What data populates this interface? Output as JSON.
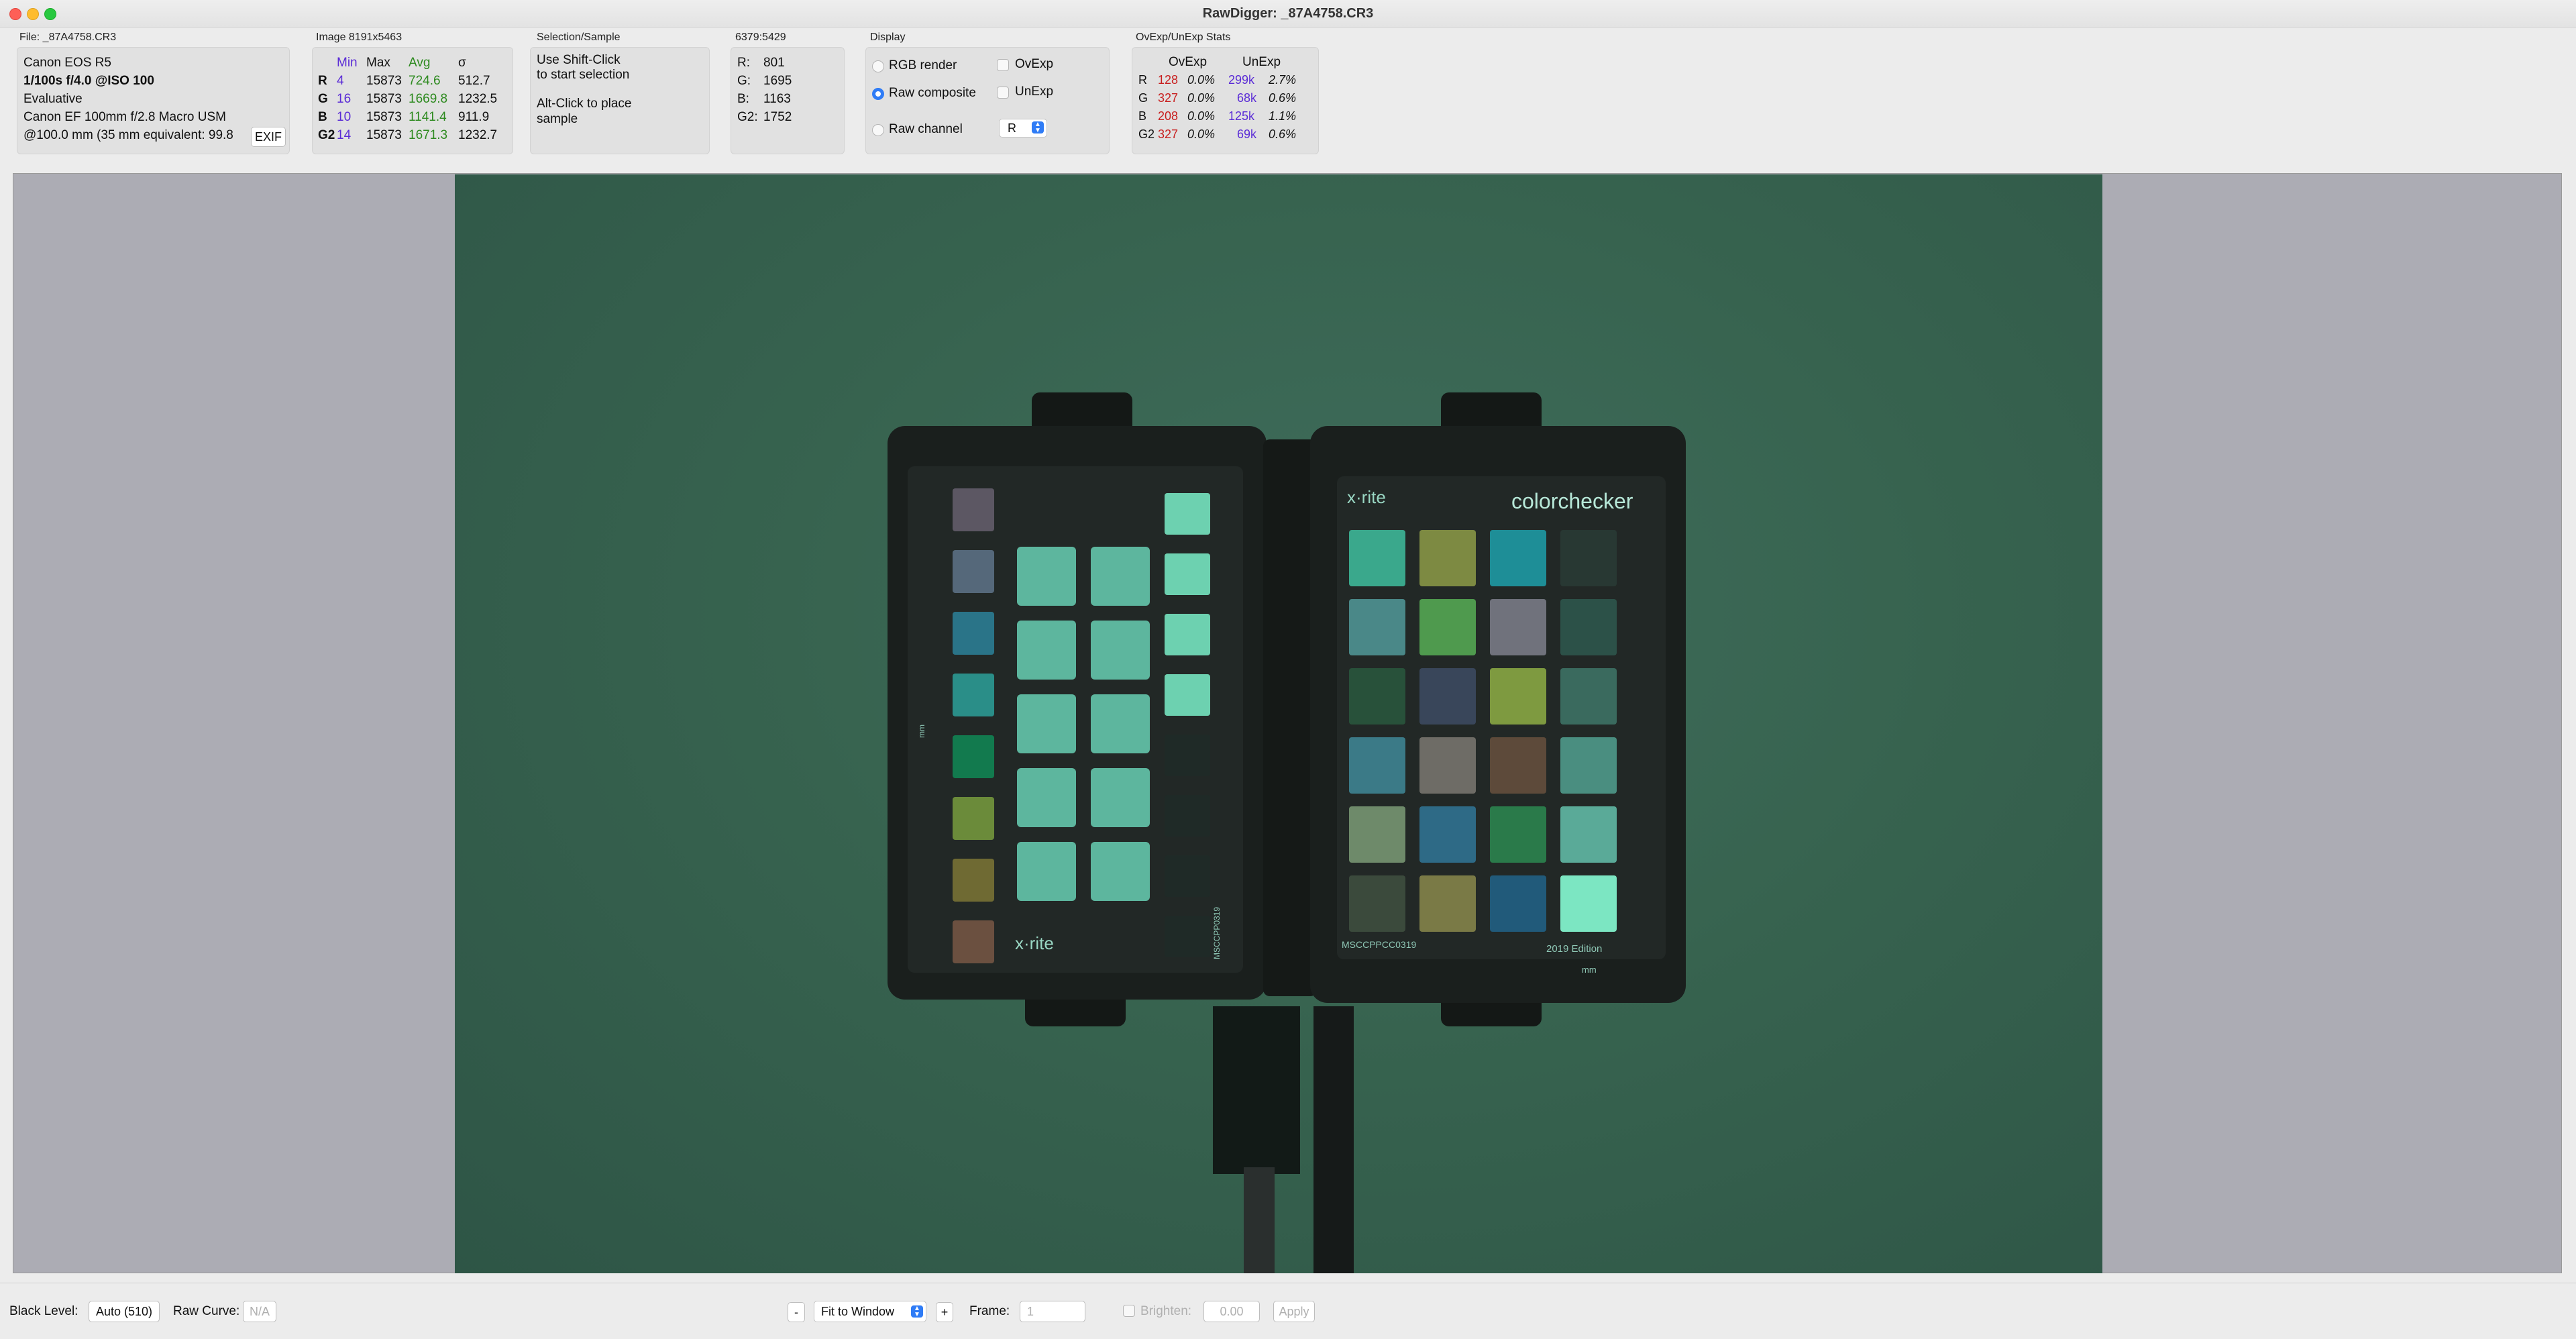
{
  "window": {
    "title": "RawDigger: _87A4758.CR3"
  },
  "file_panel": {
    "title": "File: _87A4758.CR3",
    "camera": "Canon EOS R5",
    "exposure": "1/100s f/4.0 @ISO 100",
    "metering": "Evaluative",
    "lens": "Canon EF 100mm f/2.8 Macro USM",
    "focal": "@100.0 mm (35 mm equivalent: 99.8",
    "exif_button": "EXIF"
  },
  "image_panel": {
    "title": "Image 8191x5463",
    "headers": [
      "Min",
      "Max",
      "Avg",
      "σ"
    ],
    "rows": [
      {
        "ch": "R",
        "min": "4",
        "max": "15873",
        "avg": "724.6",
        "sigma": "512.7"
      },
      {
        "ch": "G",
        "min": "16",
        "max": "15873",
        "avg": "1669.8",
        "sigma": "1232.5"
      },
      {
        "ch": "B",
        "min": "10",
        "max": "15873",
        "avg": "1141.4",
        "sigma": "911.9"
      },
      {
        "ch": "G2",
        "min": "14",
        "max": "15873",
        "avg": "1671.3",
        "sigma": "1232.7"
      }
    ]
  },
  "selection_panel": {
    "title": "Selection/Sample",
    "line1": "Use Shift-Click",
    "line2": "to start selection",
    "line3": "Alt-Click to place",
    "line4": "sample"
  },
  "pixel_panel": {
    "title": "6379:5429",
    "rows": [
      {
        "label": "R:",
        "value": "801"
      },
      {
        "label": "G:",
        "value": "1695"
      },
      {
        "label": "B:",
        "value": "1163"
      },
      {
        "label": "G2:",
        "value": "1752"
      }
    ]
  },
  "display_panel": {
    "title": "Display",
    "rgb_render": "RGB render",
    "raw_composite": "Raw composite",
    "raw_channel": "Raw channel",
    "ovexp": "OvExp",
    "unexp": "UnExp",
    "channel_value": "R"
  },
  "stats_panel": {
    "title": "OvExp/UnExp Stats",
    "headers": [
      "OvExp",
      "UnExp"
    ],
    "rows": [
      {
        "ch": "R",
        "ov": "128",
        "ovp": "0.0%",
        "un": "299k",
        "unp": "2.7%"
      },
      {
        "ch": "G",
        "ov": "327",
        "ovp": "0.0%",
        "un": "68k",
        "unp": "0.6%"
      },
      {
        "ch": "B",
        "ov": "208",
        "ovp": "0.0%",
        "un": "125k",
        "unp": "1.1%"
      },
      {
        "ch": "G2",
        "ov": "327",
        "ovp": "0.0%",
        "un": "69k",
        "unp": "0.6%"
      }
    ]
  },
  "photo": {
    "left_brand": "x·rite",
    "right_brand_1": "x·rite",
    "right_brand_2": "colorchecker",
    "left_code": "MSCCPP0319",
    "right_code": "MSCCPPCC0319",
    "edition": "2019 Edition",
    "mm_left": "mm",
    "mm_right": "mm",
    "left_swatches": [
      "#5c5763",
      "#55687a",
      "#2a7488",
      "#2a8e88",
      "#127a4e",
      "#6b8b3a",
      "#6f6a33",
      "#6b5040"
    ],
    "right_swatches": [
      "#3aa88c",
      "#7d8a42",
      "#1e8e97",
      "#283833",
      "#4a8888",
      "#4f9a4e",
      "#70727c",
      "#2c5148",
      "#28513a",
      "#39465a",
      "#7e9a40",
      "#3a6a5e",
      "#3b7a87",
      "#6e6c66",
      "#5d4a3a",
      "#4a8e80",
      "#6e8a6a",
      "#2e6a86",
      "#2a7a4a",
      "#5aaa98",
      "#3b4a3c",
      "#7a7a46",
      "#215a7a",
      "#7ce6c2"
    ]
  },
  "bottom": {
    "black_level_label": "Black Level:",
    "black_level_value": "Auto (510)",
    "raw_curve_label": "Raw Curve:",
    "raw_curve_value": "N/A",
    "zoom_minus": "-",
    "zoom_value": "Fit to Window",
    "zoom_plus": "+",
    "frame_label": "Frame:",
    "frame_value": "1",
    "brighten_label": "Brighten:",
    "brighten_value": "0.00",
    "apply": "Apply"
  }
}
